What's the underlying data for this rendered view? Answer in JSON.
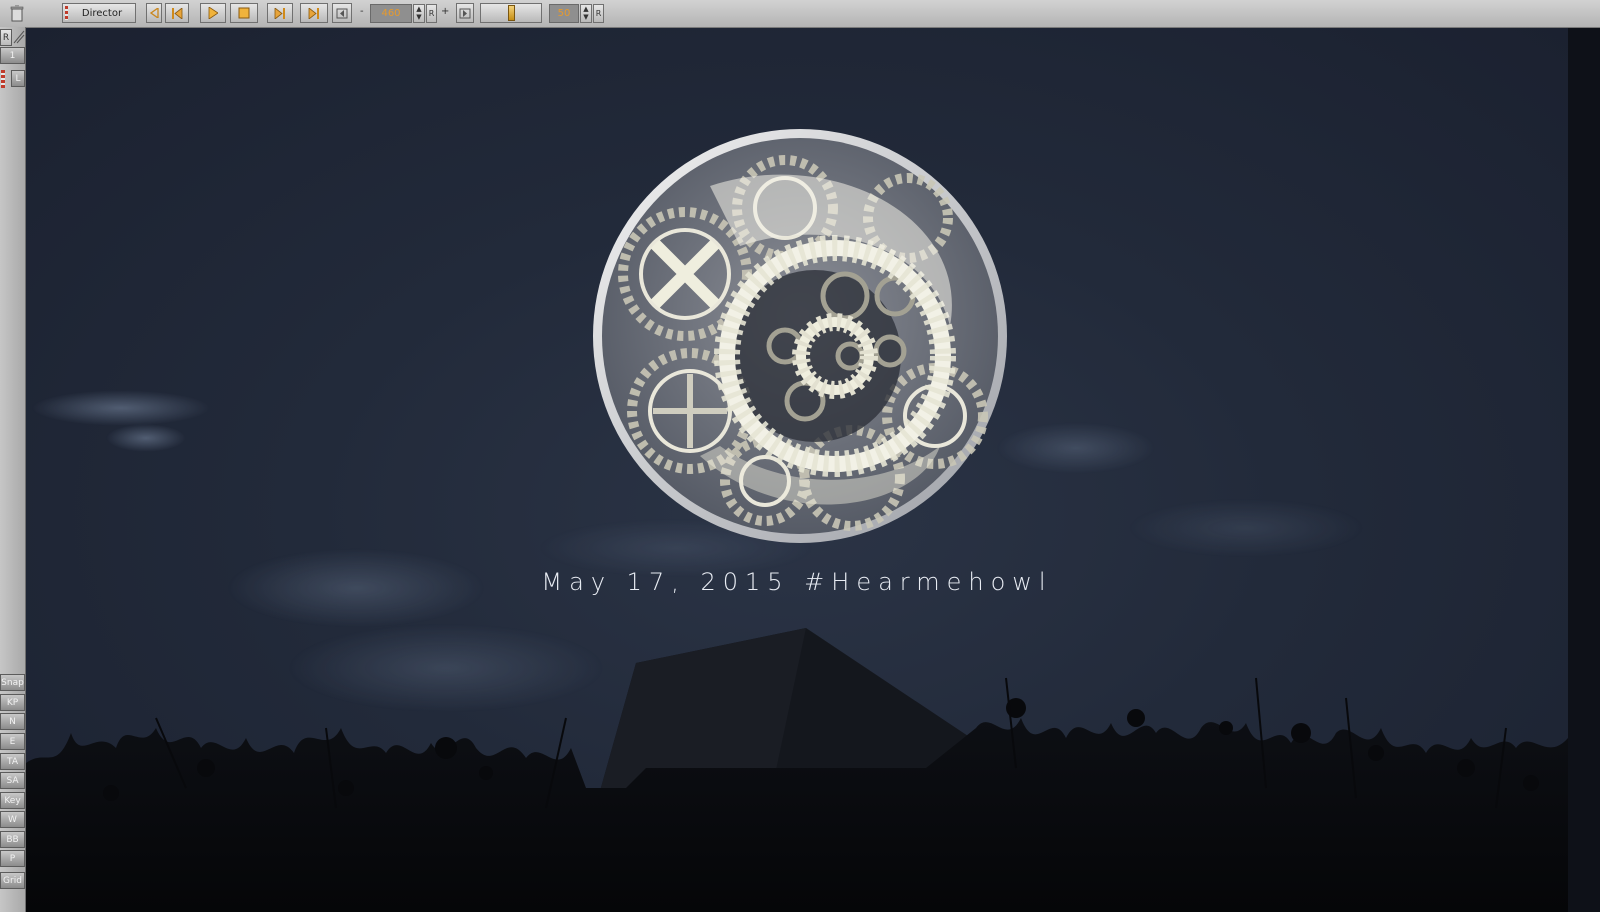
{
  "toolbar": {
    "mode_label": "Director",
    "frame_value": "460",
    "step_value": "50",
    "r_label": "R",
    "plus_label": "+",
    "minus_label": "-"
  },
  "sidebar": {
    "top": {
      "r_label": "R",
      "layer_num": "1",
      "l_label": "L"
    },
    "bottom": [
      "Snap",
      "KP",
      "N",
      "E",
      "TA",
      "SA",
      "Key",
      "W",
      "BB",
      "P",
      "Grid"
    ]
  },
  "scene": {
    "caption": "May 17, 2015 #Hearmehowl"
  },
  "colors": {
    "accent": "#e69a2e",
    "sky": "#222a3a",
    "gear": "#d9d7c9"
  },
  "icons": [
    "trash-icon",
    "prev-key-icon",
    "go-start-icon",
    "play-icon",
    "stop-icon",
    "next-frame-icon",
    "go-end-icon",
    "frame-jump-icon"
  ]
}
